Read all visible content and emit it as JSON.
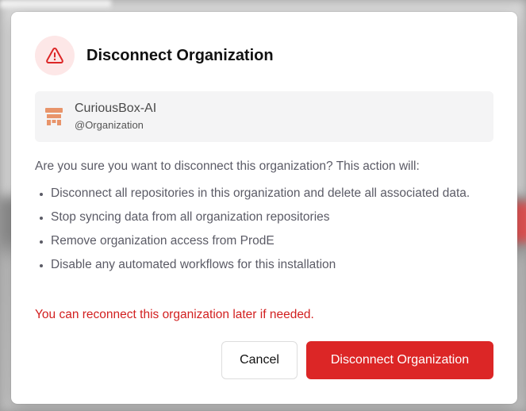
{
  "dialog": {
    "title": "Disconnect Organization",
    "organization": {
      "name": "CuriousBox-AI",
      "handle": "@Organization"
    },
    "intro": "Are you sure you want to disconnect this organization? This action will:",
    "consequences": [
      "Disconnect all repositories in this organization and delete all associated data.",
      "Stop syncing data from all organization repositories",
      "Remove organization access from ProdE",
      "Disable any automated workflows for this installation"
    ],
    "note": "You can reconnect this organization later if needed.",
    "cancel_label": "Cancel",
    "confirm_label": "Disconnect Organization"
  },
  "icons": {
    "header": "warning-triangle-icon",
    "org_avatar": "organization-logo-icon"
  },
  "colors": {
    "danger": "#dc2626",
    "danger_text": "#d21f1f",
    "warning_bg": "#fde7e7",
    "avatar": "#e8946a"
  }
}
